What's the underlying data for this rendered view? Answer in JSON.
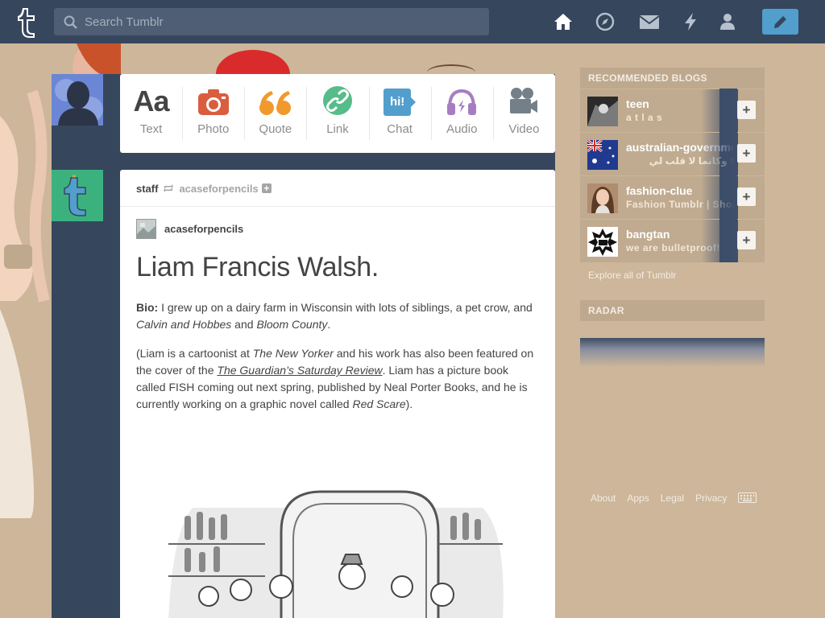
{
  "search": {
    "placeholder": "Search Tumblr"
  },
  "post_types": [
    {
      "label": "Text",
      "glyph": "Aa",
      "color": "#444444"
    },
    {
      "label": "Photo",
      "color": "#d95e40"
    },
    {
      "label": "Quote",
      "glyph": "“",
      "color": "#f2992e"
    },
    {
      "label": "Link",
      "color": "#56bc8a"
    },
    {
      "label": "Chat",
      "glyph": "hi!",
      "color": "#529ecc"
    },
    {
      "label": "Audio",
      "color": "#a77dc2"
    },
    {
      "label": "Video",
      "color": "#748089"
    }
  ],
  "post": {
    "poster": "staff",
    "reblogged_from": "acaseforpencils",
    "follow_icon": "+",
    "reblog_author": "acaseforpencils",
    "title": "Liam Francis Walsh.",
    "bio_label": "Bio:",
    "bio_text_1": " I grew up on a dairy farm in Wisconsin with lots of siblings, a pet crow, and ",
    "bio_italic_1": "Calvin and Hobbes",
    "bio_text_2": " and ",
    "bio_italic_2": "Bloom County",
    "bio_text_3": ".",
    "p2_text_1": "(Liam is a cartoonist at ",
    "p2_italic_1": "The New Yorker",
    "p2_text_2": " and his work has also been featured on the cover of the ",
    "p2_link": "The Guardian’s Saturday Review",
    "p2_text_3": ". Liam has a picture book called FISH coming out next spring, published by Neal Porter Books, and he is currently working on a graphic novel called ",
    "p2_italic_2": "Red Scare",
    "p2_text_4": ")."
  },
  "sidebar": {
    "recommended_title": "RECOMMENDED BLOGS",
    "blogs": [
      {
        "name": "teen",
        "subtitle": "a t l a s",
        "add": "+"
      },
      {
        "name": "australian-government",
        "subtitle": "لا وكانما لا قلب لي",
        "add": "+"
      },
      {
        "name": "fashion-clue",
        "subtitle": "Fashion Tumblr | Shop",
        "add": "+"
      },
      {
        "name": "bangtan",
        "subtitle": "we are bulletproof!",
        "add": "+"
      }
    ],
    "explore": "Explore all of Tumblr",
    "radar_title": "RADAR"
  },
  "footer": {
    "links": [
      "About",
      "Apps",
      "Legal",
      "Privacy"
    ]
  },
  "colors": {
    "topbar": "#36465d",
    "background": "#cdb699",
    "compose": "#529ecc"
  }
}
